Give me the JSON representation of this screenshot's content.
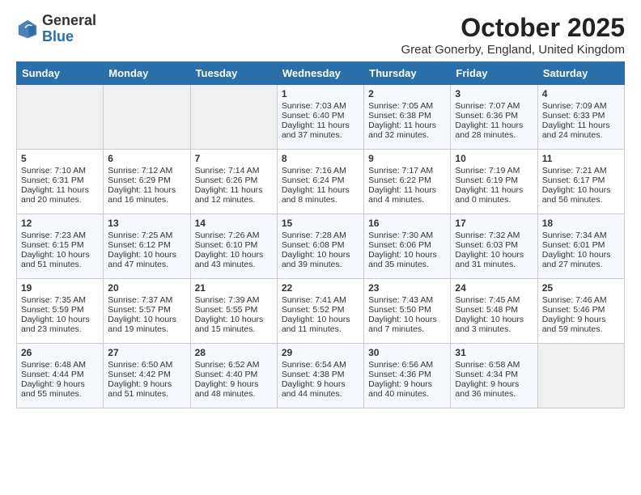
{
  "header": {
    "logo_general": "General",
    "logo_blue": "Blue",
    "month_title": "October 2025",
    "location": "Great Gonerby, England, United Kingdom"
  },
  "weekdays": [
    "Sunday",
    "Monday",
    "Tuesday",
    "Wednesday",
    "Thursday",
    "Friday",
    "Saturday"
  ],
  "weeks": [
    [
      {
        "day": "",
        "empty": true
      },
      {
        "day": "",
        "empty": true
      },
      {
        "day": "",
        "empty": true
      },
      {
        "day": "1",
        "sunrise": "7:03 AM",
        "sunset": "6:40 PM",
        "daylight": "11 hours and 37 minutes."
      },
      {
        "day": "2",
        "sunrise": "7:05 AM",
        "sunset": "6:38 PM",
        "daylight": "11 hours and 32 minutes."
      },
      {
        "day": "3",
        "sunrise": "7:07 AM",
        "sunset": "6:36 PM",
        "daylight": "11 hours and 28 minutes."
      },
      {
        "day": "4",
        "sunrise": "7:09 AM",
        "sunset": "6:33 PM",
        "daylight": "11 hours and 24 minutes."
      }
    ],
    [
      {
        "day": "5",
        "sunrise": "7:10 AM",
        "sunset": "6:31 PM",
        "daylight": "11 hours and 20 minutes."
      },
      {
        "day": "6",
        "sunrise": "7:12 AM",
        "sunset": "6:29 PM",
        "daylight": "11 hours and 16 minutes."
      },
      {
        "day": "7",
        "sunrise": "7:14 AM",
        "sunset": "6:26 PM",
        "daylight": "11 hours and 12 minutes."
      },
      {
        "day": "8",
        "sunrise": "7:16 AM",
        "sunset": "6:24 PM",
        "daylight": "11 hours and 8 minutes."
      },
      {
        "day": "9",
        "sunrise": "7:17 AM",
        "sunset": "6:22 PM",
        "daylight": "11 hours and 4 minutes."
      },
      {
        "day": "10",
        "sunrise": "7:19 AM",
        "sunset": "6:19 PM",
        "daylight": "11 hours and 0 minutes."
      },
      {
        "day": "11",
        "sunrise": "7:21 AM",
        "sunset": "6:17 PM",
        "daylight": "10 hours and 56 minutes."
      }
    ],
    [
      {
        "day": "12",
        "sunrise": "7:23 AM",
        "sunset": "6:15 PM",
        "daylight": "10 hours and 51 minutes."
      },
      {
        "day": "13",
        "sunrise": "7:25 AM",
        "sunset": "6:12 PM",
        "daylight": "10 hours and 47 minutes."
      },
      {
        "day": "14",
        "sunrise": "7:26 AM",
        "sunset": "6:10 PM",
        "daylight": "10 hours and 43 minutes."
      },
      {
        "day": "15",
        "sunrise": "7:28 AM",
        "sunset": "6:08 PM",
        "daylight": "10 hours and 39 minutes."
      },
      {
        "day": "16",
        "sunrise": "7:30 AM",
        "sunset": "6:06 PM",
        "daylight": "10 hours and 35 minutes."
      },
      {
        "day": "17",
        "sunrise": "7:32 AM",
        "sunset": "6:03 PM",
        "daylight": "10 hours and 31 minutes."
      },
      {
        "day": "18",
        "sunrise": "7:34 AM",
        "sunset": "6:01 PM",
        "daylight": "10 hours and 27 minutes."
      }
    ],
    [
      {
        "day": "19",
        "sunrise": "7:35 AM",
        "sunset": "5:59 PM",
        "daylight": "10 hours and 23 minutes."
      },
      {
        "day": "20",
        "sunrise": "7:37 AM",
        "sunset": "5:57 PM",
        "daylight": "10 hours and 19 minutes."
      },
      {
        "day": "21",
        "sunrise": "7:39 AM",
        "sunset": "5:55 PM",
        "daylight": "10 hours and 15 minutes."
      },
      {
        "day": "22",
        "sunrise": "7:41 AM",
        "sunset": "5:52 PM",
        "daylight": "10 hours and 11 minutes."
      },
      {
        "day": "23",
        "sunrise": "7:43 AM",
        "sunset": "5:50 PM",
        "daylight": "10 hours and 7 minutes."
      },
      {
        "day": "24",
        "sunrise": "7:45 AM",
        "sunset": "5:48 PM",
        "daylight": "10 hours and 3 minutes."
      },
      {
        "day": "25",
        "sunrise": "7:46 AM",
        "sunset": "5:46 PM",
        "daylight": "9 hours and 59 minutes."
      }
    ],
    [
      {
        "day": "26",
        "sunrise": "6:48 AM",
        "sunset": "4:44 PM",
        "daylight": "9 hours and 55 minutes."
      },
      {
        "day": "27",
        "sunrise": "6:50 AM",
        "sunset": "4:42 PM",
        "daylight": "9 hours and 51 minutes."
      },
      {
        "day": "28",
        "sunrise": "6:52 AM",
        "sunset": "4:40 PM",
        "daylight": "9 hours and 48 minutes."
      },
      {
        "day": "29",
        "sunrise": "6:54 AM",
        "sunset": "4:38 PM",
        "daylight": "9 hours and 44 minutes."
      },
      {
        "day": "30",
        "sunrise": "6:56 AM",
        "sunset": "4:36 PM",
        "daylight": "9 hours and 40 minutes."
      },
      {
        "day": "31",
        "sunrise": "6:58 AM",
        "sunset": "4:34 PM",
        "daylight": "9 hours and 36 minutes."
      },
      {
        "day": "",
        "empty": true
      }
    ]
  ]
}
